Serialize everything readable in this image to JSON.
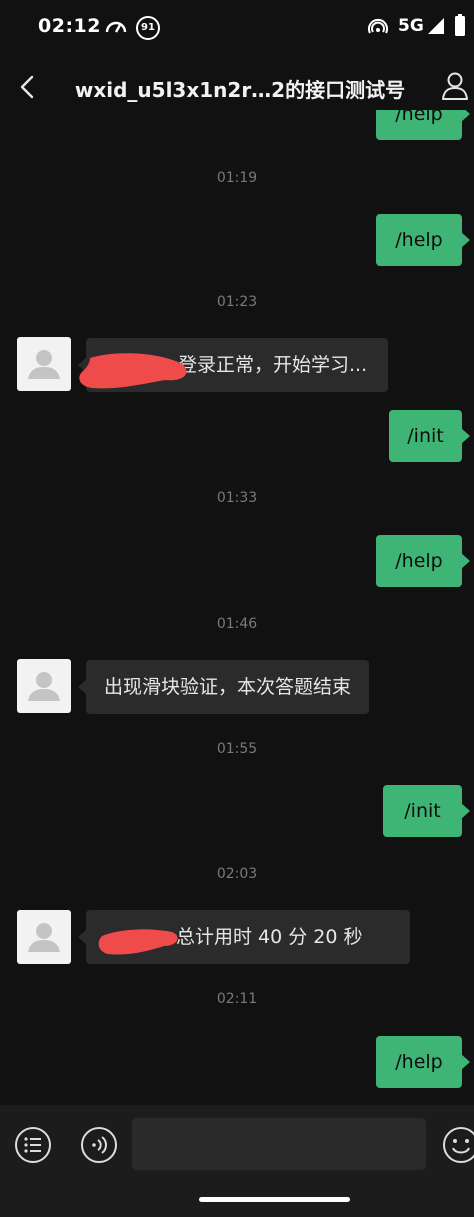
{
  "status_bar": {
    "time": "02:12",
    "badge": "91",
    "network": "5G"
  },
  "header": {
    "title": "wxid_u5l3x1n2r…2的接口测试号"
  },
  "messages": [
    {
      "type": "out",
      "text": "/help"
    },
    {
      "type": "timestamp",
      "text": "01:19"
    },
    {
      "type": "out",
      "text": "/help"
    },
    {
      "type": "timestamp",
      "text": "01:23"
    },
    {
      "type": "in",
      "text": "登录正常，开始学习..."
    },
    {
      "type": "out",
      "text": "/init"
    },
    {
      "type": "timestamp",
      "text": "01:33"
    },
    {
      "type": "out",
      "text": "/help"
    },
    {
      "type": "timestamp",
      "text": "01:46"
    },
    {
      "type": "in",
      "text": "出现滑块验证，本次答题结束"
    },
    {
      "type": "timestamp",
      "text": "01:55"
    },
    {
      "type": "out",
      "text": "/init"
    },
    {
      "type": "timestamp",
      "text": "02:03"
    },
    {
      "type": "in",
      "text": "总计用时 40 分 20 秒"
    },
    {
      "type": "timestamp",
      "text": "02:11"
    },
    {
      "type": "out",
      "text": "/help"
    }
  ],
  "input": {
    "placeholder": ""
  },
  "colors": {
    "background": "#111111",
    "outgoing_bubble": "#3eb575",
    "incoming_bubble": "#2b2b2b",
    "redaction": "#f04b4b"
  },
  "icons": [
    "back-arrow-icon",
    "profile-icon",
    "list-icon",
    "voice-icon",
    "emoji-icon"
  ]
}
